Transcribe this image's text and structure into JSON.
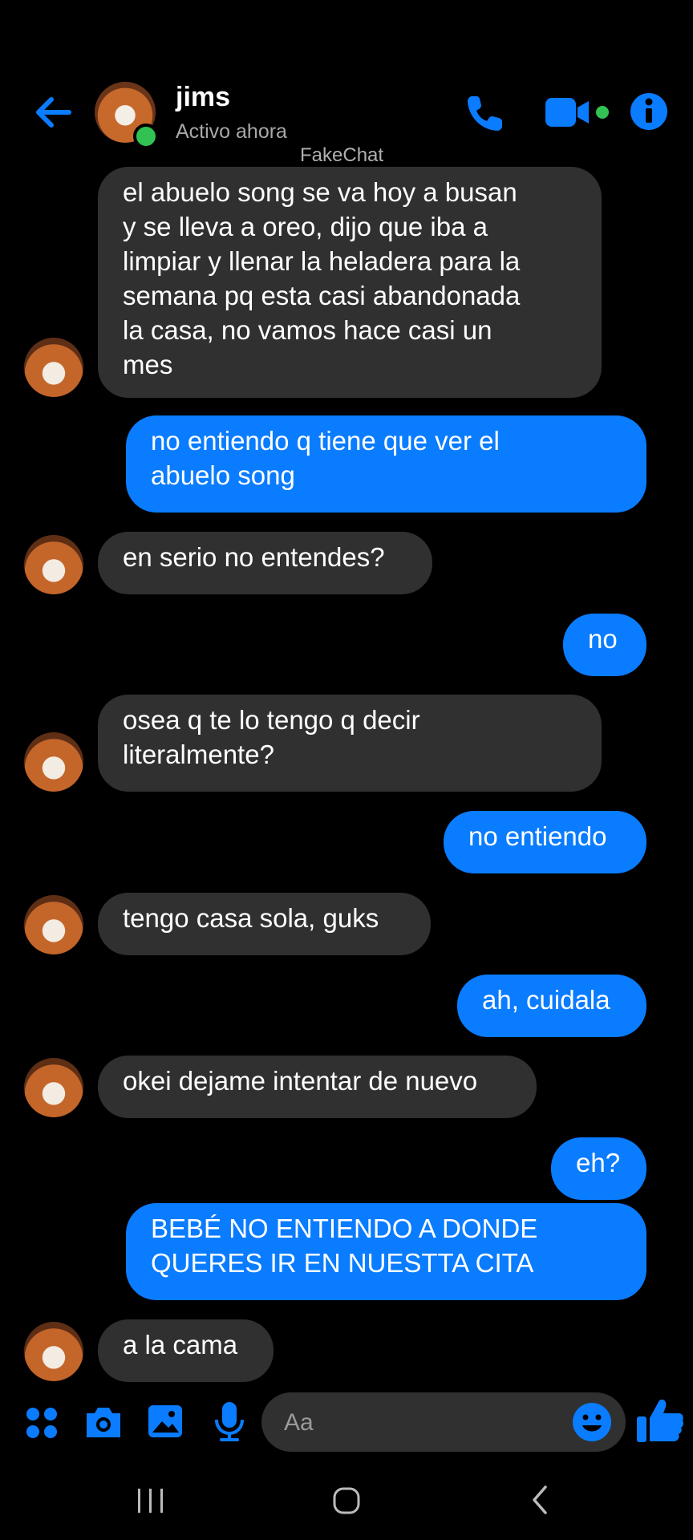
{
  "header": {
    "contact_name": "jims",
    "status": "Activo ahora",
    "watermark": "FakeChat"
  },
  "messages": [
    {
      "side": "in",
      "text": "el abuelo song se va hoy a busan\ny se lleva a oreo, dijo que iba a\nlimpiar y llenar la heladera para la\nsemana pq esta casi abandonada\nla casa, no vamos hace casi un\nmes"
    },
    {
      "side": "out",
      "text": "no entiendo q tiene que ver el\nabuelo song"
    },
    {
      "side": "in",
      "text": "en serio no entendes?"
    },
    {
      "side": "out",
      "text": "no"
    },
    {
      "side": "in",
      "text": "osea q te lo tengo q decir\nliteralmente?"
    },
    {
      "side": "out",
      "text": "no entiendo"
    },
    {
      "side": "in",
      "text": "tengo casa sola, guks"
    },
    {
      "side": "out",
      "text": "ah, cuidala"
    },
    {
      "side": "in",
      "text": "okei dejame intentar de nuevo"
    },
    {
      "side": "out",
      "text": "eh?"
    },
    {
      "side": "out",
      "text": "BEBÉ NO ENTIENDO A DONDE\nQUERES IR EN NUESTTA CITA"
    },
    {
      "side": "in",
      "text": "a la cama"
    }
  ],
  "composer": {
    "placeholder": "Aa"
  },
  "colors": {
    "accent": "#0a7cff",
    "incoming_bubble": "#303030",
    "background": "#000000",
    "online": "#31c253"
  },
  "icons": [
    "back-arrow-icon",
    "phone-icon",
    "video-camera-icon",
    "info-icon",
    "apps-grid-icon",
    "camera-icon",
    "gallery-icon",
    "microphone-icon",
    "emoji-icon",
    "thumbs-up-icon",
    "nav-recents-icon",
    "nav-home-icon",
    "nav-back-icon"
  ]
}
